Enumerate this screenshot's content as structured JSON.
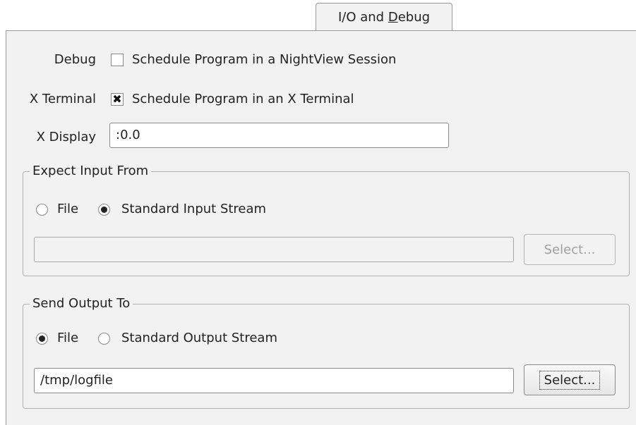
{
  "tab": {
    "label_pre": "I/O and ",
    "label_mnemonic": "D",
    "label_post": "ebug"
  },
  "debug": {
    "label": "Debug",
    "checkbox_label": "Schedule Program in a NightView Session",
    "checked": false
  },
  "xterm": {
    "label": "X Terminal",
    "checkbox_label": "Schedule Program in an X Terminal",
    "checked": true
  },
  "xdisplay": {
    "label": "X Display",
    "value": ":0.0"
  },
  "input_group": {
    "legend": "Expect Input From",
    "options": [
      "File",
      "Standard Input Stream"
    ],
    "selected": "Standard Input Stream",
    "file_value": "",
    "select_label": "Select..."
  },
  "output_group": {
    "legend": "Send Output To",
    "options": [
      "File",
      "Standard Output Stream"
    ],
    "selected": "File",
    "file_value": "/tmp/logfile",
    "select_label": "Select..."
  }
}
